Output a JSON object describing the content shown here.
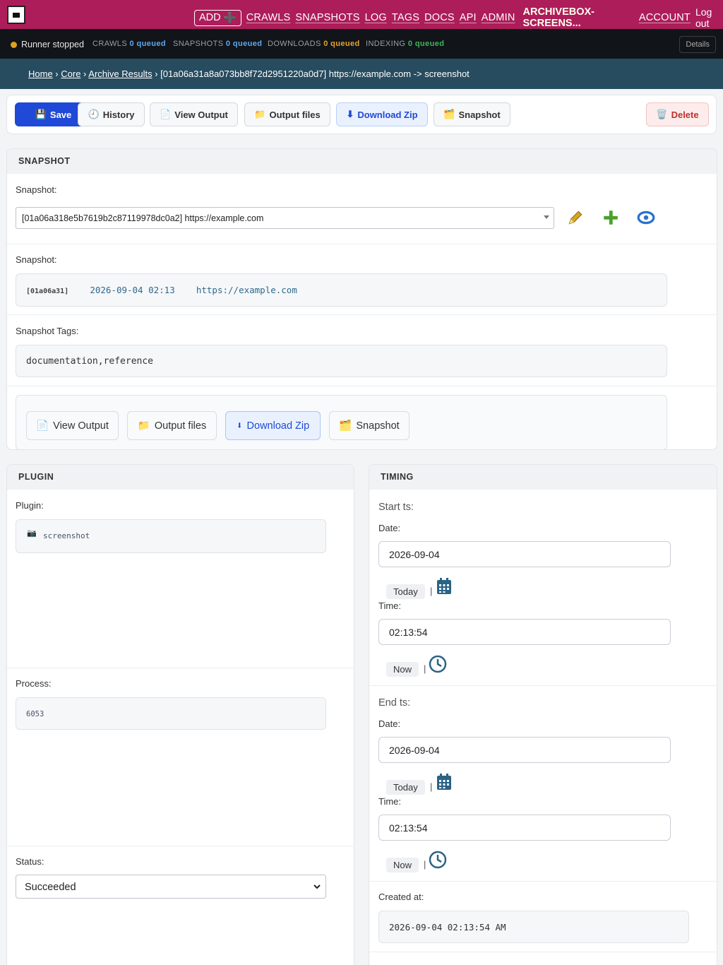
{
  "nav": {
    "add_label": "ADD",
    "links": [
      "CRAWLS",
      "SNAPSHOTS",
      "LOG",
      "TAGS",
      "DOCS",
      "API",
      "ADMIN"
    ],
    "user": "ARCHIVEBOX-SCREENS...",
    "account": "ACCOUNT",
    "logout": "Log out"
  },
  "status": {
    "runner": "Runner stopped",
    "crawls_label": "CRAWLS",
    "crawls_value": "0 queued",
    "snapshots_label": "SNAPSHOTS",
    "snapshots_value": "0 queued",
    "downloads_label": "DOWNLOADS",
    "downloads_value": "0 queued",
    "indexing_label": "INDEXING",
    "indexing_value": "0 queued",
    "details": "Details"
  },
  "breadcrumb": {
    "home": "Home",
    "core": "Core",
    "archive_results": "Archive Results",
    "current": "[01a06a31a8a073bb8f72d2951220a0d7] https://example.com -> screenshot"
  },
  "actions": {
    "save": "Save",
    "history": "History",
    "view_output": "View Output",
    "output_files": "Output files",
    "download_zip": "Download Zip",
    "snapshot": "Snapshot",
    "delete": "Delete"
  },
  "snapshot_panel": {
    "title": "SNAPSHOT",
    "select_label": "Snapshot:",
    "select_value": "[01a06a318e5b7619b2c87119978dc0a2] https://example.com",
    "info_label": "Snapshot:",
    "info_id": "[01a06a31]",
    "info_date": "2026-09-04 02:13",
    "info_url": "https://example.com",
    "tags_label": "Snapshot Tags:",
    "tags_value": "documentation,reference",
    "inner_buttons": {
      "view_output": "View Output",
      "output_files": "Output files",
      "download_zip": "Download Zip",
      "snapshot": "Snapshot"
    }
  },
  "plugin_panel": {
    "title": "PLUGIN",
    "plugin_label": "Plugin:",
    "plugin_value": "screenshot",
    "process_label": "Process:",
    "process_value": "6053",
    "status_label": "Status:",
    "status_value": "Succeeded"
  },
  "timing_panel": {
    "title": "TIMING",
    "start_heading": "Start ts:",
    "start_date_label": "Date:",
    "start_date": "2026-09-04",
    "start_today": "Today",
    "start_time_label": "Time:",
    "start_time": "02:13:54",
    "start_now": "Now",
    "end_heading": "End ts:",
    "end_date_label": "Date:",
    "end_date": "2026-09-04",
    "end_today": "Today",
    "end_time_label": "Time:",
    "end_time": "02:13:54",
    "end_now": "Now",
    "created_label": "Created at:",
    "created_value": "2026-09-04 02:13:54 AM",
    "pipe": "|"
  },
  "colors": {
    "topbar": "#ad1d5a",
    "statusbar": "#111418",
    "breadcrumb": "#274b5f",
    "primary": "#1f49d6",
    "danger": "#c0302c"
  },
  "icons": [
    "save-icon",
    "history-icon",
    "page-icon",
    "folder-icon",
    "download-icon",
    "snapshot-icon",
    "trash-icon",
    "pencil-icon",
    "plus-icon",
    "eye-icon",
    "camera-icon",
    "calendar-icon",
    "clock-icon"
  ]
}
